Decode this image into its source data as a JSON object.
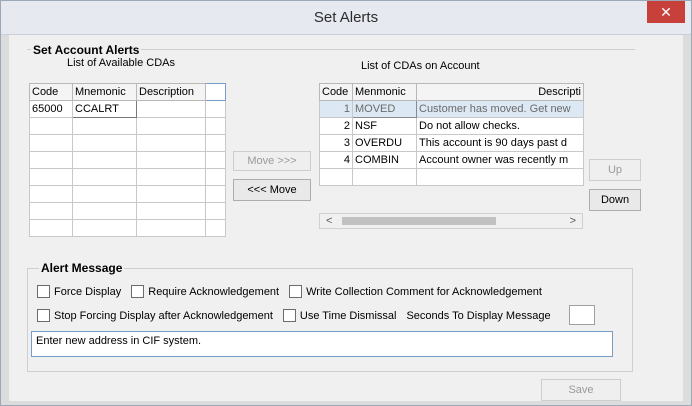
{
  "window": {
    "title": "Set Alerts",
    "close_glyph": "✕"
  },
  "account_alerts": {
    "group_title": "Set Account Alerts",
    "available_label": "List of Available CDAs",
    "available_columns": [
      "Code",
      "Mnemonic",
      "Description"
    ],
    "available_rows": [
      {
        "code": "65000",
        "mnemonic": "CCALRT",
        "description": ""
      }
    ],
    "on_account_label": "List of CDAs on Account",
    "on_account_columns": [
      "Code",
      "Menmonic",
      "Descripti"
    ],
    "on_account_rows": [
      {
        "code": "1",
        "mnemonic": "MOVED",
        "description": "Customer has moved. Get new"
      },
      {
        "code": "2",
        "mnemonic": "NSF",
        "description": "Do not allow checks."
      },
      {
        "code": "3",
        "mnemonic": "OVERDU",
        "description": "This account is 90 days past d"
      },
      {
        "code": "4",
        "mnemonic": "COMBIN",
        "description": "Account owner was recently m"
      }
    ],
    "move_right_label": "Move >>>",
    "move_left_label": "<<< Move",
    "up_label": "Up",
    "down_label": "Down",
    "scroll_left_glyph": "<",
    "scroll_right_glyph": ">"
  },
  "alert_message": {
    "group_title": "Alert Message",
    "force_display": "Force Display",
    "require_ack": "Require Acknowledgement",
    "write_comment": "Write Collection Comment for Acknowledgement",
    "stop_forcing": "Stop Forcing Display after Acknowledgement",
    "time_dismissal": "Use Time Dismissal",
    "seconds_label": "Seconds To Display Message",
    "message_text": "Enter new address in CIF system."
  },
  "save_label": "Save",
  "colors": {
    "close": "#c7403a",
    "selected_row": "#dce8f4"
  }
}
